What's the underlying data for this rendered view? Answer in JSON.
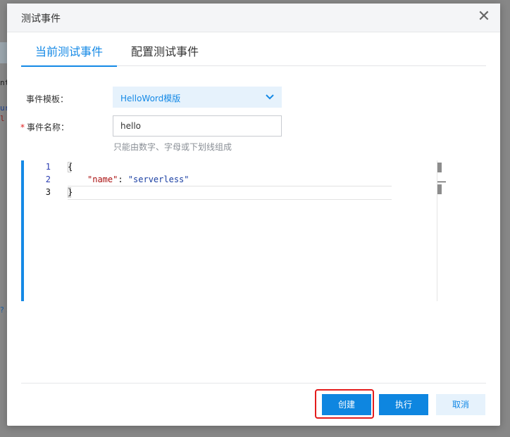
{
  "background": {
    "code_lines": [
      "nt",
      "ur",
      "l",
      ""
    ],
    "link_text": "? 和"
  },
  "modal": {
    "title": "测试事件",
    "close_glyph": "✕"
  },
  "tabs": [
    {
      "label": "当前测试事件",
      "active": true
    },
    {
      "label": "配置测试事件",
      "active": false
    }
  ],
  "form": {
    "template_label": "事件模板：",
    "template_value": "HelloWord模版",
    "name_label": "事件名称：",
    "required_mark": "*",
    "name_value": "hello",
    "name_hint": "只能由数字、字母或下划线组成"
  },
  "editor": {
    "line_numbers": [
      "1",
      "2",
      "3"
    ],
    "lines": {
      "line1": "{",
      "line2_key": "\"name\"",
      "line2_sep": ": ",
      "line2_value": "\"serverless\"",
      "line3": "}"
    },
    "current_line": 3
  },
  "footer": {
    "create_label": "创建",
    "run_label": "执行",
    "cancel_label": "取消"
  },
  "colors": {
    "accent": "#1489e6",
    "highlight": "#e41b1b"
  },
  "icons": {
    "close": "close-icon",
    "chevron": "chevron-down-icon"
  }
}
